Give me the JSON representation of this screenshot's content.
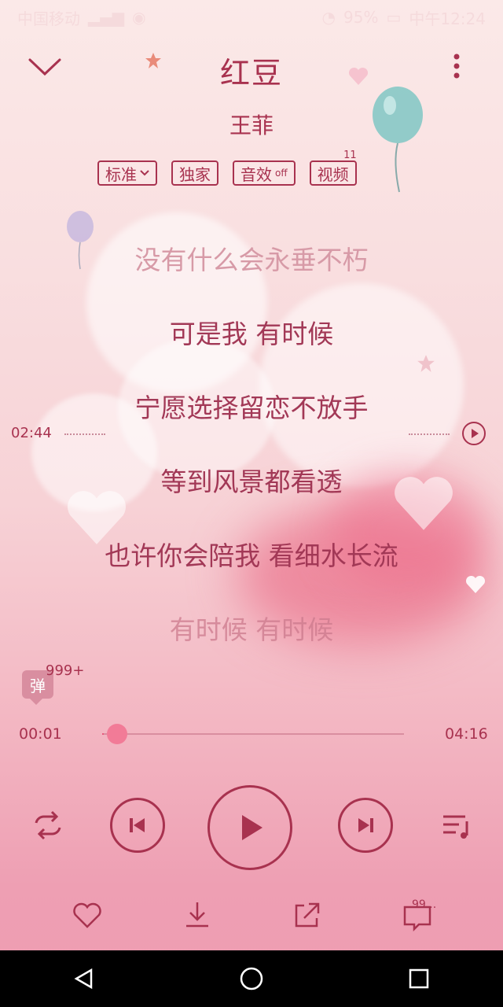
{
  "statusbar": {
    "carrier": "中国移动",
    "battery": "95%",
    "time": "中午12:24"
  },
  "song": {
    "title": "红豆",
    "artist": "王菲"
  },
  "tags": {
    "quality": "标准",
    "exclusive": "独家",
    "effect": "音效",
    "effect_state": "off",
    "video": "视频",
    "video_count": "11"
  },
  "lyrics": [
    "没有什么会永垂不朽",
    "可是我 有时候",
    "宁愿选择留恋不放手",
    "等到风景都看透",
    "也许你会陪我 看细水长流",
    "有时候 有时候"
  ],
  "lyric_seek_time": "02:44",
  "danmu": {
    "label": "弹",
    "count": "999+"
  },
  "progress": {
    "current": "00:01",
    "total": "04:16",
    "fraction": 0.004
  },
  "comment_count": "99..."
}
